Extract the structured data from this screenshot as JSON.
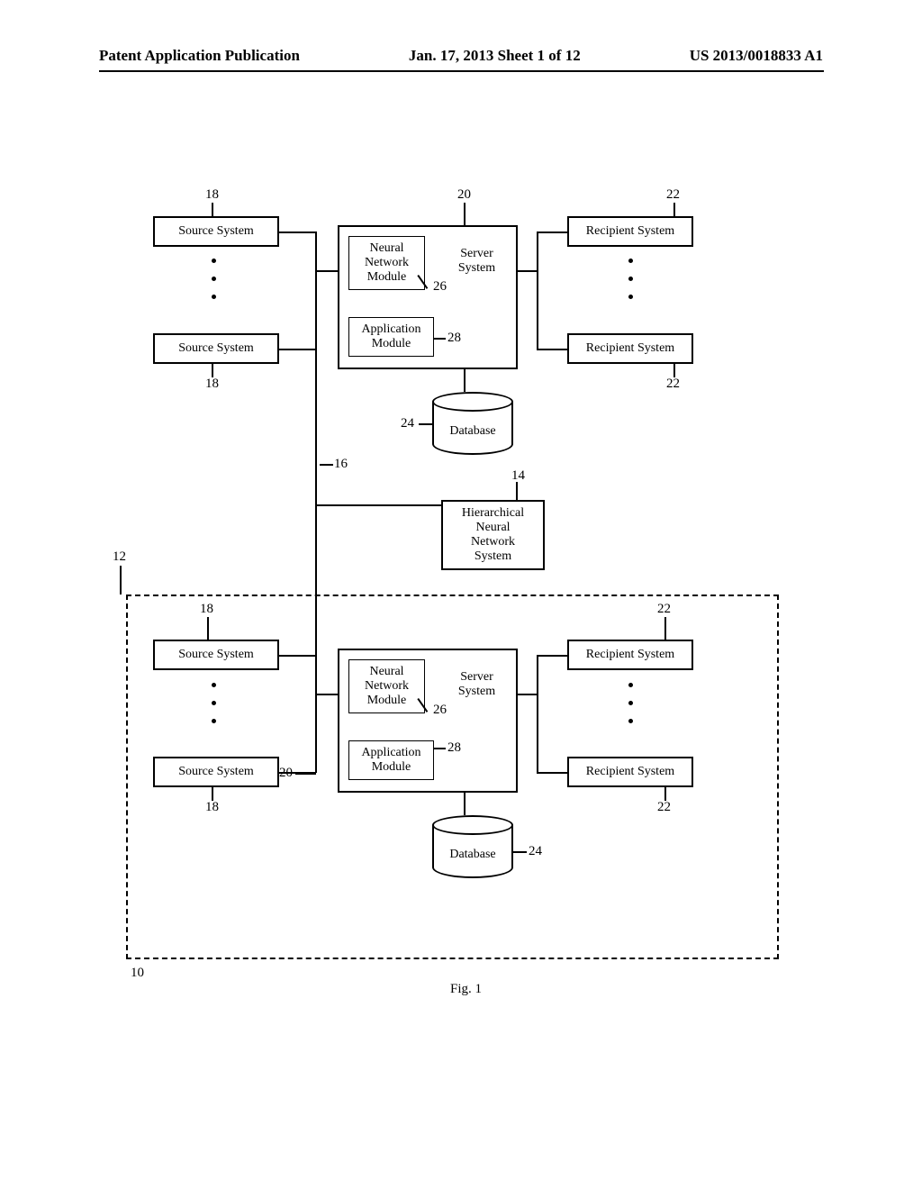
{
  "header": {
    "left": "Patent Application Publication",
    "center": "Jan. 17, 2013  Sheet 1 of 12",
    "right": "US 2013/0018833 A1"
  },
  "figure": {
    "caption": "Fig. 1",
    "refs": {
      "r10": "10",
      "r12": "12",
      "r14": "14",
      "r16": "16",
      "r18a": "18",
      "r18b": "18",
      "r18c": "18",
      "r18d": "18",
      "r20a": "20",
      "r20b": "20",
      "r22a": "22",
      "r22b": "22",
      "r22c": "22",
      "r22d": "22",
      "r24a": "24",
      "r24b": "24",
      "r26a": "26",
      "r26b": "26",
      "r28a": "28",
      "r28b": "28"
    },
    "labels": {
      "source_system": "Source System",
      "recipient_system": "Recipient System",
      "neural_network_module": "Neural\nNetwork\nModule",
      "application_module": "Application\nModule",
      "server_system": "Server\nSystem",
      "database": "Database",
      "hierarchical": "Hierarchical\nNeural\nNetwork\nSystem"
    }
  }
}
